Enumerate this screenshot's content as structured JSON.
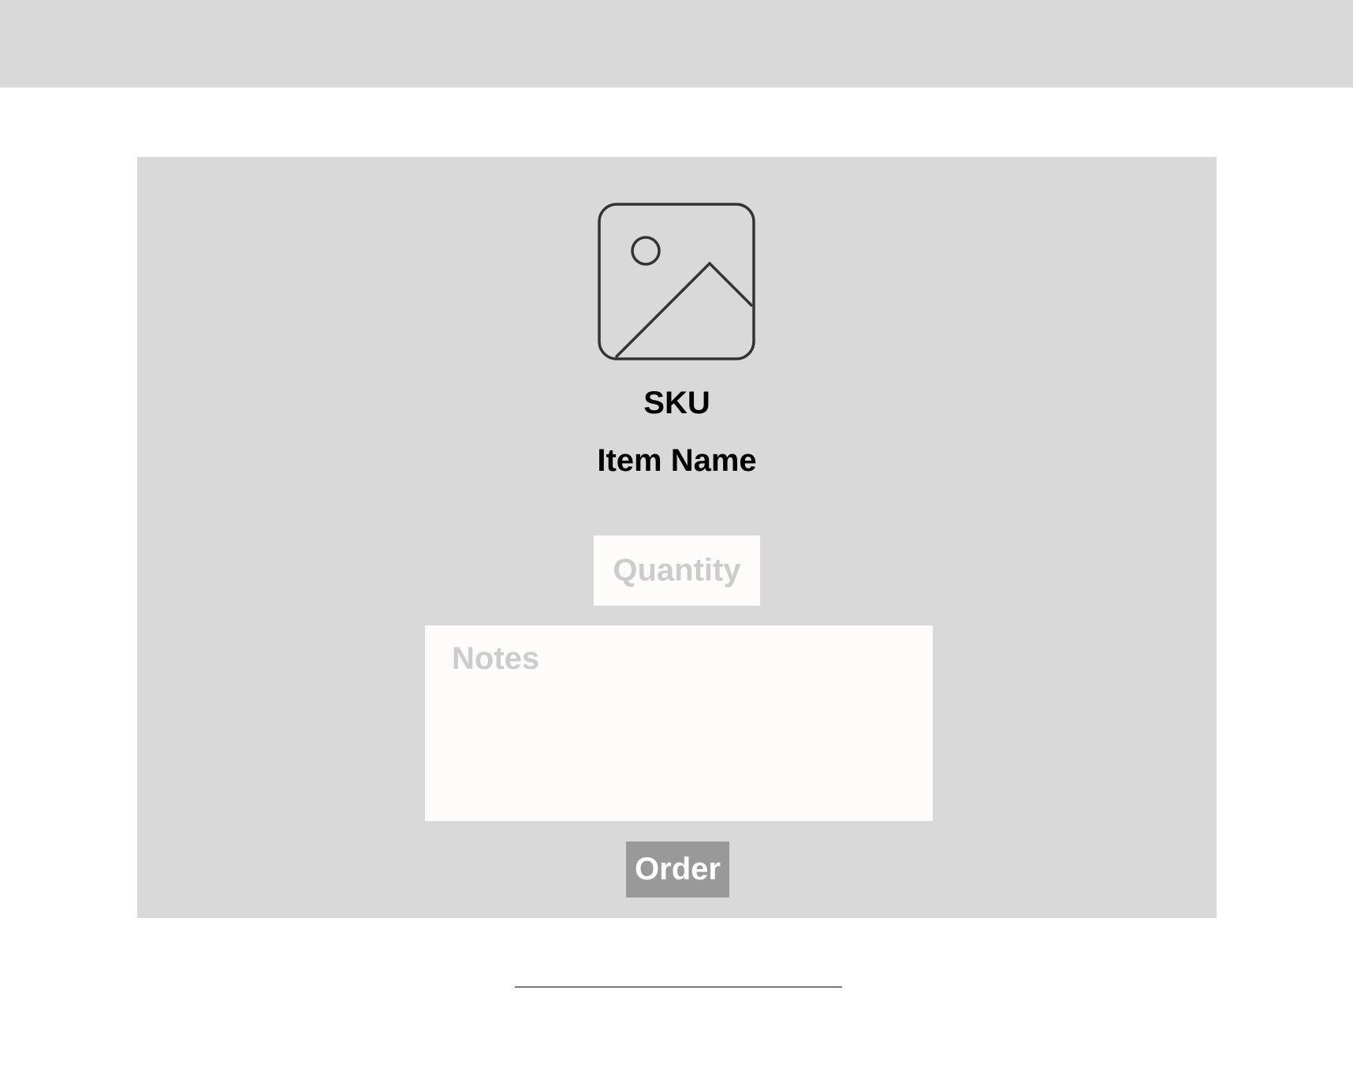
{
  "product": {
    "sku_label": "SKU",
    "item_name": "Item Name",
    "image_icon": "image-placeholder-icon"
  },
  "form": {
    "quantity_placeholder": "Quantity",
    "quantity_value": "",
    "notes_placeholder": "Notes",
    "notes_value": "",
    "order_label": "Order"
  },
  "colors": {
    "panel_background": "#d9d9d9",
    "input_background": "#fffbfb",
    "placeholder_text": "#cccccc",
    "button_background": "#999999",
    "button_text": "#ffffff",
    "icon_stroke": "#333333"
  }
}
